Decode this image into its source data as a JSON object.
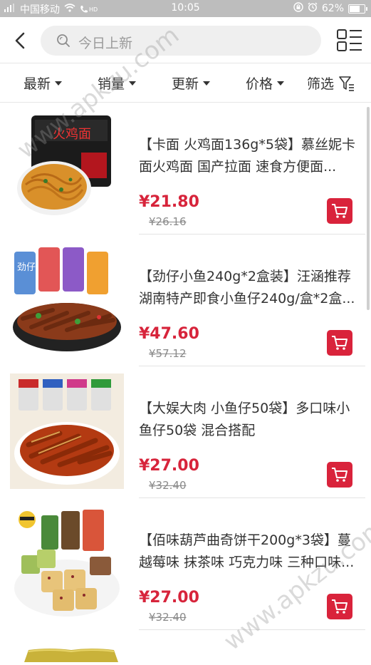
{
  "status_bar": {
    "carrier": "中国移动",
    "network": "HD",
    "time": "10:05",
    "battery": "62%",
    "battery_level": 0.62
  },
  "search": {
    "placeholder": "今日上新"
  },
  "filters": [
    {
      "label": "最新",
      "icon": "caret-down-icon"
    },
    {
      "label": "销量",
      "icon": "caret-down-icon"
    },
    {
      "label": "更新",
      "icon": "caret-down-icon"
    },
    {
      "label": "价格",
      "icon": "caret-down-icon"
    },
    {
      "label": "筛选",
      "icon": "filter-funnel-icon"
    }
  ],
  "products": [
    {
      "title": "【卡面 火鸡面136g*5袋】慕丝妮卡面火鸡面 国产拉面 速食方便面...",
      "price": "¥21.80",
      "original_price": "¥26.16"
    },
    {
      "title": "【劲仔小鱼240g*2盒装】汪涵推荐湖南特产即食小鱼仔240g/盒*2盒...",
      "price": "¥47.60",
      "original_price": "¥57.12"
    },
    {
      "title": "【大娱大肉 小鱼仔50袋】多口味小鱼仔50袋 混合搭配",
      "price": "¥27.00",
      "original_price": "¥32.40"
    },
    {
      "title": "【佰味葫芦曲奇饼干200g*3袋】蔓越莓味 抹茶味 巧克力味 三种口味...",
      "price": "¥27.00",
      "original_price": "¥32.40"
    }
  ],
  "thumb_labels": {
    "p1": "火鸡面",
    "p2": "劲仔"
  },
  "watermark": "www.apkzu.com",
  "colors": {
    "accent": "#d9233b",
    "price": "#d7243b",
    "status_bar": "#bdbdbd"
  }
}
